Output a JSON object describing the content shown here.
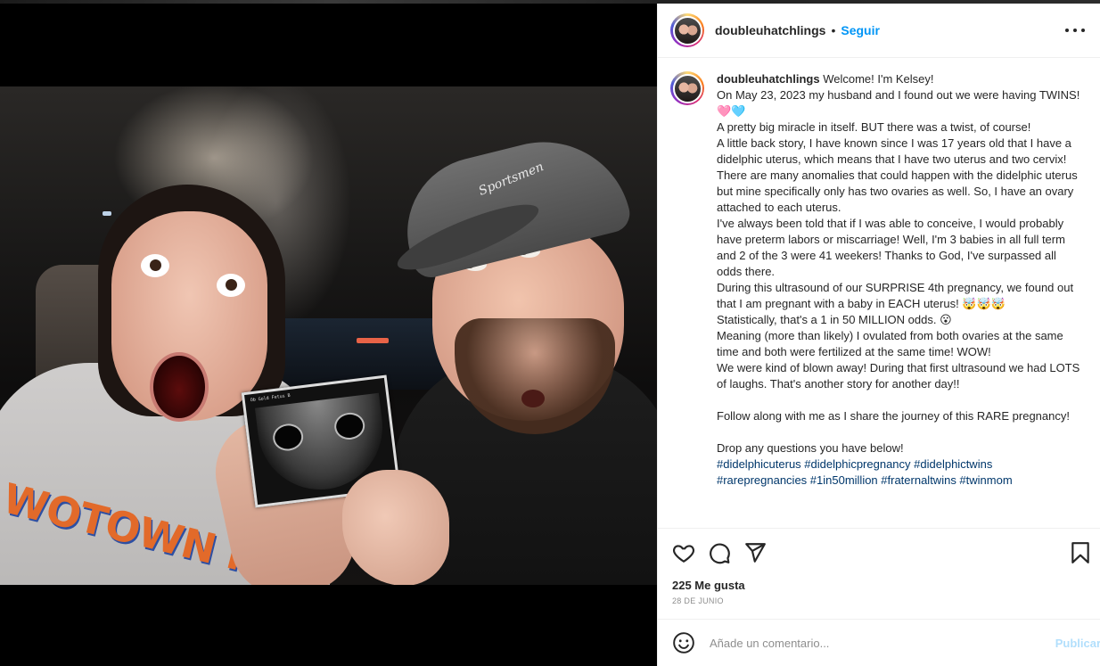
{
  "post": {
    "username": "doubleuhatchlings",
    "separator": "•",
    "follow_label": "Seguir",
    "caption_lines": [
      "Welcome! I'm Kelsey!",
      "On May 23, 2023 my husband and I found out we were having TWINS! 🩷🩵",
      "A pretty big miracle in itself. BUT there was a twist, of course!",
      "A little back story, I have known since I was 17 years old that I have a didelphic uterus, which means that I have two uterus and two cervix! There are many anomalies that could happen with the didelphic uterus but mine specifically only has two ovaries as well. So, I have an ovary attached to each uterus.",
      "I've always been told that if I was able to conceive, I would probably have preterm labors or miscarriage! Well, I'm 3 babies in all full term and 2 of the 3 were 41 weekers! Thanks to God, I've surpassed all odds there.",
      "During this ultrasound of our SURPRISE 4th pregnancy, we found out that I am pregnant with a baby in EACH uterus! 🤯🤯🤯",
      "Statistically, that's a 1 in 50 MILLION odds. 😮",
      "Meaning (more than likely) I ovulated from both ovaries at the same time and both were fertilized at the same time! WOW!",
      "We were kind of blown away! During that first ultrasound we had LOTS of laughs. That's another story for another day!!",
      "",
      "Follow along with me as I share the journey of this RARE pregnancy!",
      "",
      "Drop any questions you have below!",
      ""
    ],
    "hashtags": "#didelphicuterus #didelphicpregnancy #didelphictwins #rarepregnancies #1in50million #fraternaltwins #twinmom",
    "likes": "225 Me gusta",
    "date": "28 DE JUNIO",
    "comment_placeholder": "Añade un comentario...",
    "publish_label": "Publicar"
  },
  "photo": {
    "shirt_text": "WOTOWN F",
    "cap_logo": "Sportsmen",
    "ultrasound_header": "Ob Gold  Fetus B"
  },
  "icons": {
    "more": "more-options-icon",
    "like": "heart-icon",
    "comment": "comment-icon",
    "share": "share-icon",
    "save": "bookmark-icon",
    "emoji": "emoji-icon"
  },
  "colors": {
    "link_blue": "#0095f6",
    "hashtag_blue": "#00376b",
    "publish_disabled": "#b2dffc",
    "text": "#262626",
    "muted": "#8e8e8e"
  }
}
